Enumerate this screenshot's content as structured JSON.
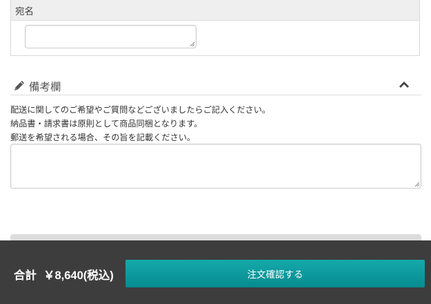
{
  "address": {
    "label": "宛名",
    "input_value": ""
  },
  "remarks": {
    "icon": "pencil-icon",
    "title": "備考欄",
    "collapse_icon": "chevron-up-icon",
    "notes": [
      "配送に関してのご希望やご質問などございましたらご記入ください。",
      "納品書・請求書は原則として商品同梱となります。",
      "郵送を希望される場合、その旨を記載ください。"
    ],
    "textarea_value": ""
  },
  "footer": {
    "total_label": "合計",
    "total_amount": "￥8,640(税込)",
    "confirm_label": "注文確認する",
    "background_color": "#3d3d3d",
    "button_color": "#0e9ea1"
  }
}
